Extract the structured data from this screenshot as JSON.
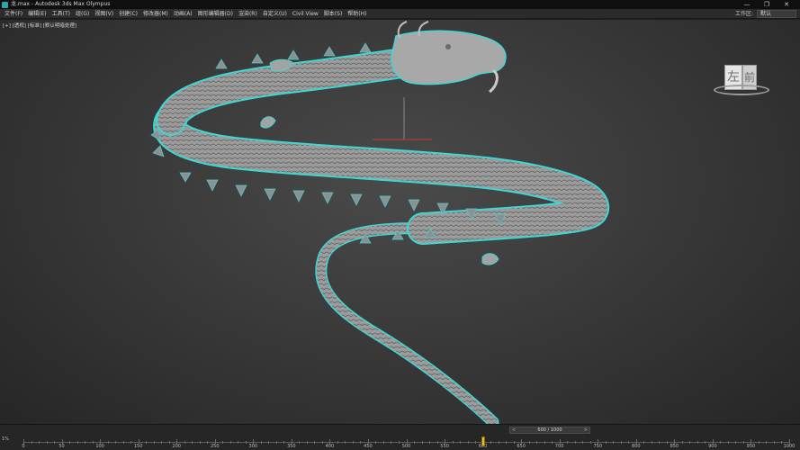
{
  "titlebar": {
    "title": "龙.max - Autodesk 3ds Max Olympus",
    "minimize": "—",
    "maximize": "❐",
    "close": "✕"
  },
  "menubar": {
    "items": [
      "文件(F)",
      "编辑(E)",
      "工具(T)",
      "组(G)",
      "视图(V)",
      "创建(C)",
      "修改器(M)",
      "动画(A)",
      "图形编辑器(D)",
      "渲染(R)",
      "自定义(U)",
      "Civil View",
      "脚本(S)",
      "帮助(H)"
    ],
    "workspace_label": "工作区:",
    "workspace_value": "默认"
  },
  "viewport": {
    "label": "[+] [透视] [标准] [默认明暗处理]",
    "viewcube_left": "左",
    "viewcube_front": "前"
  },
  "timeline": {
    "frame_display": "600 / 1000",
    "prev": "<",
    "next": ">",
    "corner": "1%",
    "ticks": [
      "0",
      "50",
      "100",
      "150",
      "200",
      "250",
      "300",
      "350",
      "400",
      "450",
      "500",
      "550",
      "600",
      "650",
      "700",
      "750",
      "800",
      "850",
      "900",
      "950",
      "1000"
    ],
    "current_frame": 600,
    "total_frames": 1000
  },
  "colors": {
    "selection_outline": "#3fd6d6",
    "dragon_body": "#9a9a9a",
    "playhead": "#e6c227"
  }
}
